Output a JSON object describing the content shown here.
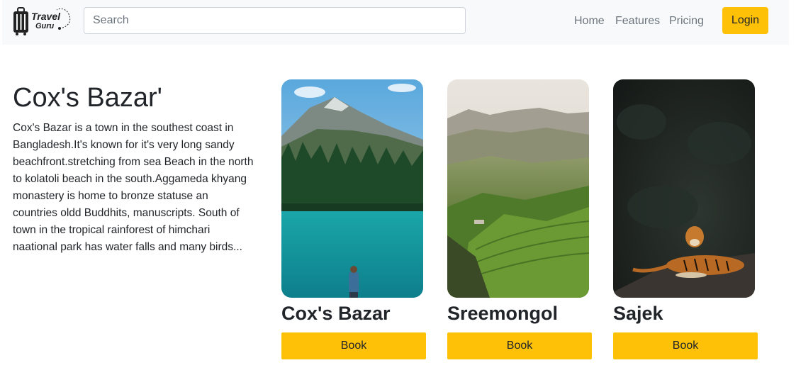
{
  "brand": {
    "logo_line1": "Travel",
    "logo_line2": "Guru"
  },
  "search": {
    "placeholder": "Search",
    "value": ""
  },
  "nav": {
    "items": [
      "Home",
      "Features",
      "Pricing"
    ],
    "login_label": "Login",
    "accent": "#ffc107"
  },
  "intro": {
    "title": "Cox's Bazar'",
    "description": "Cox's Bazar is a town in the southest coast in Bangladesh.It's known for it's very long sandy beachfront.stretching from sea Beach in the north to kolatoli beach in the south.Aggameda khyang monastery is home to bronze statuse an countries oldd Buddhits, manuscripts. South of town in the tropical rainforest of himchari naational park has water falls and many birds..."
  },
  "cards": [
    {
      "title": "Cox's Bazar",
      "button": "Book",
      "image": "mountain-lake-forest-photo"
    },
    {
      "title": "Sreemongol",
      "button": "Book",
      "image": "tea-garden-hills-photo"
    },
    {
      "title": "Sajek",
      "button": "Book",
      "image": "tiger-resting-photo"
    }
  ]
}
